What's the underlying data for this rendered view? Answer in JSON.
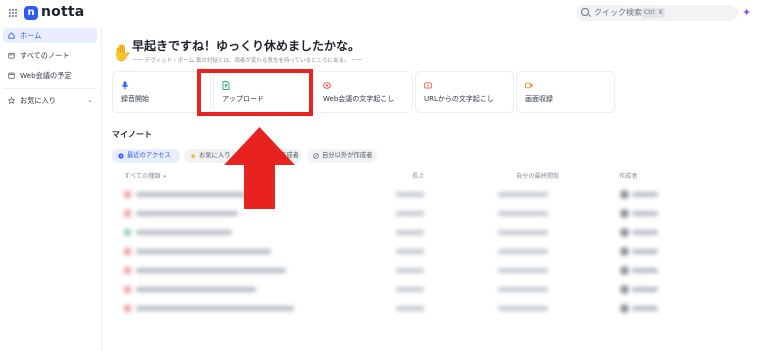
{
  "app": {
    "logo_letter": "n",
    "name": "notta",
    "accent": "#2f5cf5"
  },
  "search": {
    "placeholder": "クイック検索",
    "key1": "Ctrl",
    "key2": "K"
  },
  "sidebar": {
    "items": [
      {
        "label": "ホーム",
        "icon": "home-icon",
        "active": true
      },
      {
        "label": "すべてのノート",
        "icon": "folder-icon",
        "active": false
      },
      {
        "label": "Web会議の予定",
        "icon": "calendar-icon",
        "active": false
      },
      {
        "label": "お気に入り",
        "icon": "star-icon",
        "active": false,
        "expandable": true
      }
    ]
  },
  "main": {
    "greeting": "早起きですね！ゆっくり休めましたかな。",
    "quote": "ーー デヴィッド・ボーム 真の対話とは、両者が変わる意志を持っているところにある。 ーー",
    "actions": [
      {
        "label": "録音開始",
        "icon": "mic-icon",
        "color": "#2f5cf5"
      },
      {
        "label": "アップロード",
        "icon": "upload-icon",
        "color": "#1fb36b"
      },
      {
        "label": "Web会議の文字起こし",
        "icon": "meeting-icon",
        "color": "#e8455a"
      },
      {
        "label": "URLからの文字起こし",
        "icon": "video-icon",
        "color": "#f06a4b"
      },
      {
        "label": "画面収録",
        "icon": "screen-record-icon",
        "color": "#f08a24"
      }
    ],
    "notes_title": "マイノート",
    "filters": [
      {
        "label": "最近のアクセス",
        "icon": "clock-icon",
        "active": true
      },
      {
        "label": "お気に入り",
        "icon": "star-icon",
        "active": false
      },
      {
        "label": "作成者",
        "icon": "person-icon",
        "active": false
      },
      {
        "label": "自分以外が作成者",
        "icon": "share-icon",
        "active": false
      }
    ],
    "columns": [
      "すべての種類",
      "長さ",
      "自分の最終閲覧",
      "作成者"
    ]
  },
  "annotation": {
    "color": "#e8231f"
  }
}
